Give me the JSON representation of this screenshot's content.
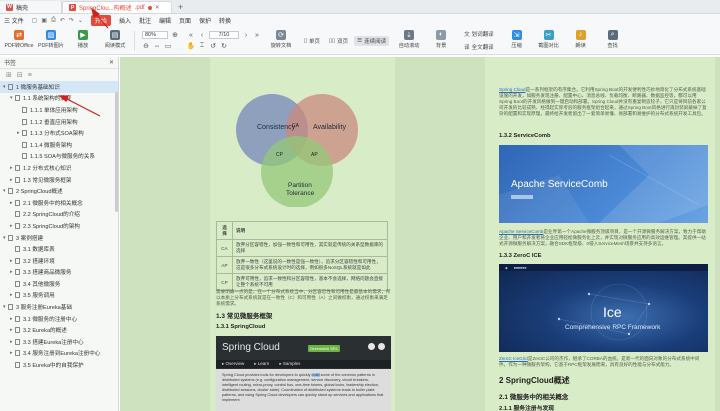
{
  "tabs": {
    "home": "稿壳",
    "doc": "SpringClou...构概述",
    "doc_ext": ".pdf",
    "plus": "+"
  },
  "menu": {
    "items": [
      "三 文件",
      "开始",
      "插入",
      "批注",
      "编辑",
      "页面",
      "保护",
      "转换"
    ],
    "active_index": 1
  },
  "toolbar": {
    "buttons": [
      {
        "label": "PDF转Office",
        "icon": "pdf-to-office-icon",
        "color": "#e06e2c"
      },
      {
        "label": "PDF转图片",
        "icon": "pdf-to-image-icon",
        "color": "#2f8de4"
      },
      {
        "label": "播放",
        "icon": "play-icon",
        "color": "#3a9a4a"
      },
      {
        "label": "阅读模式",
        "icon": "read-mode-icon",
        "color": "#5a6b7a"
      }
    ],
    "zoom": "80%",
    "page_current": "7",
    "page_total": "/10",
    "rotate_label": "旋转文档",
    "single_label": "单页",
    "double_label": "双页",
    "continuous_label": "连续阅读",
    "auto_scroll_label": "自动滚动",
    "background_label": "背景",
    "translate_label": "划词翻译",
    "full_translate_label": "全文翻译",
    "compress_label": "压缩",
    "screenshot_label": "截图对比",
    "read_aloud_label": "朗读",
    "find_label": "查找"
  },
  "sidebar": {
    "title": "书签",
    "items": [
      {
        "label": "1 微服务基础知识",
        "level": 0,
        "expanded": true,
        "selected": true
      },
      {
        "label": "1.1 系统架构的演变",
        "level": 1,
        "expanded": true
      },
      {
        "label": "1.1.1 单体应用架构",
        "level": 2
      },
      {
        "label": "1.1.2 垂直应用架构",
        "level": 2
      },
      {
        "label": "1.1.3 分布式SOA架构",
        "level": 2,
        "expanded": false
      },
      {
        "label": "1.1.4 微服务架构",
        "level": 2
      },
      {
        "label": "1.1.5 SOA与微服务的关系",
        "level": 2
      },
      {
        "label": "1.2 分布式核心知识",
        "level": 1,
        "expanded": false
      },
      {
        "label": "1.3 常见微服务框架",
        "level": 1,
        "expanded": false
      },
      {
        "label": "2 SpringCloud概述",
        "level": 0,
        "expanded": true
      },
      {
        "label": "2.1 微服务中的相关概念",
        "level": 1,
        "expanded": false
      },
      {
        "label": "2.2 SpringCloud的介绍",
        "level": 1
      },
      {
        "label": "2.3 SpringCloud的架构",
        "level": 1,
        "expanded": false
      },
      {
        "label": "3 案例搭建",
        "level": 0,
        "expanded": true
      },
      {
        "label": "3.1 数据库表",
        "level": 1
      },
      {
        "label": "3.2 搭建环境",
        "level": 1,
        "expanded": false
      },
      {
        "label": "3.3 搭建商品微服务",
        "level": 1,
        "expanded": false
      },
      {
        "label": "3.4 其他微服务",
        "level": 1
      },
      {
        "label": "3.5 服务调用",
        "level": 1,
        "expanded": false
      },
      {
        "label": "3 服务注册Eureka基础",
        "level": 0,
        "expanded": true
      },
      {
        "label": "3.1 微服务的注册中心",
        "level": 1,
        "expanded": false
      },
      {
        "label": "3.2 Eureka的概述",
        "level": 1,
        "expanded": false
      },
      {
        "label": "3.3 搭建Eureka注册中心",
        "level": 1,
        "expanded": false
      },
      {
        "label": "3.4 服务注册到Eureka注册中心",
        "level": 1,
        "expanded": false
      },
      {
        "label": "3.5 Eureka中的自我保护",
        "level": 1
      }
    ]
  },
  "page1": {
    "venn": {
      "c": "Consistency",
      "a": "Availability",
      "p": "Partition Tolerance",
      "p1": "Partition",
      "p2": "Tolerance",
      "ca": "CA",
      "cp": "CP",
      "ap": "AP"
    },
    "table": {
      "head": [
        "选择",
        "说明"
      ],
      "rows": [
        [
          "CA",
          "放弃分区容错性，加强一致性和可用性，其实就是传统的关系型数据库的选择"
        ],
        [
          "AP",
          "放弃一致性（这里说的一致性是强一致性），追求分区容错性和可用性，这是很多分布式系统设计时的选择，例如很多NoSQL系统就是如此"
        ],
        [
          "CP",
          "放弃可用性，追求一致性和分区容错性，基本不会选择，网络问题会直接让整个系统不可用"
        ]
      ]
    },
    "para": "需要明确一点的是，在一个分布式系统当中，分区容忍性和可用性是最基本的需求，所以本质上分布式系统就是在一致性（C）和可用性（A）之间做权衡，通过权衡来满足系统需求。",
    "h_common": "1.3 常见微服务框架",
    "h_springcloud": "1.3.1 SpringCloud",
    "sc_site": {
      "title": "Spring Cloud",
      "badge": "Greenwich SR1",
      "nav": [
        "Overview",
        "Learn",
        "Samples"
      ],
      "text": "Spring Cloud provides tools for developers to quickly build some of the common patterns in distributed systems (e.g. configuration management, service discovery, circuit breakers, intelligent routing, micro-proxy, control bus, one-time tokens, global locks, leadership election, distributed sessions, cluster state). Coordination of distributed systems leads to boiler plate patterns, and using Spring Cloud developers can quickly stand up services and applications that implement",
      "highlight": "build"
    }
  },
  "page2": {
    "intro_link": "Spring Cloud",
    "intro": "是一系列框架的有序集合。它利用Spring Boot的开发便利性巧妙地简化了分布式系统基础设施的开发，如服务发现注册、配置中心、消息总线、负载均衡、断路器、数据监控等，都可以用Spring Boot的开发风格做到一键启动和部署。Spring Cloud并没有重复制造轮子，它只是将目前各家公司开发的比较成熟、经得起实际考验的服务框架组合起来，通过Spring Boot风格进行再封装屏蔽掉了复杂的配置和实现原理，最终给开发者留出了一套简单易懂、易部署和易维护的分布式系统开发工具包。",
    "h_servicecomb": "1.3.2 ServiceComb",
    "sc_banner_title": "Apache ServiceComb",
    "sc_desc_link": "Apache ServiceComb",
    "sc_desc": "是业界第一个Apache微服务顶级项目，是一个开源微服务解决方案，致力于帮助企业、用户和开发者将企业应用轻松微服务化上云，并实现对微服务应用的高效运维管理。其提供一站式开源微服务解决方案，融合SDK框架级、0侵入ServiceMesh场景并支持多语言。",
    "h_zeroc": "1.3.3 ZeroC ICE",
    "zeroc_big": "Ice",
    "zeroc_sub": "Comprehensive RPC Framework",
    "zeroc_desc_link": "ZeroC IceGrid",
    "zeroc_desc": "是ZeroC公司的杰作，继承了CORBA的血统，是新一代的面向对象的分布式系统中间件。作为一种微服务架构，它基于RPC框架发展而来，具有良好的性能与分布式能力。",
    "h_sc_overview": "2 SpringCloud概述",
    "h_related": "2.1 微服务中的相关概念",
    "h_reg": "2.1.1 服务注册与发现"
  }
}
